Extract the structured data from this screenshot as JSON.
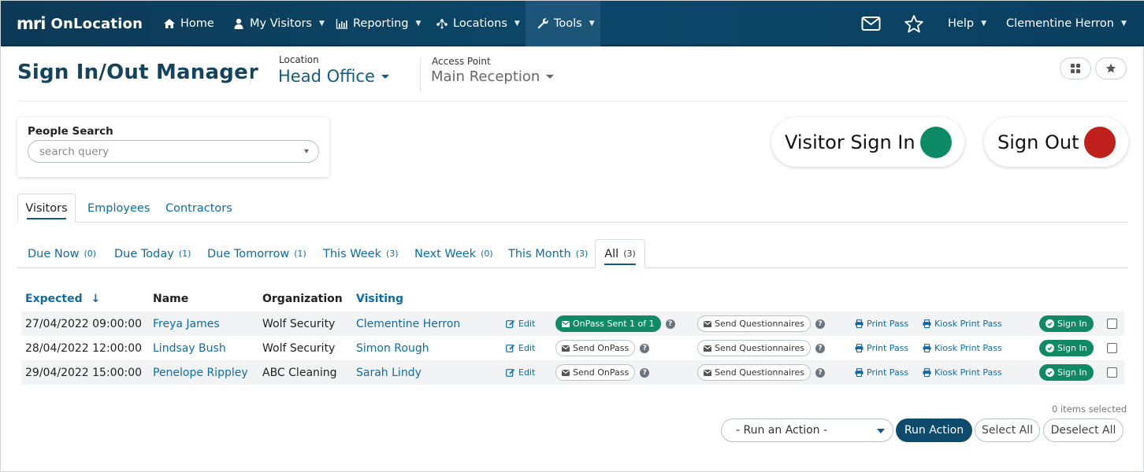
{
  "nav": {
    "brand_mark": "mri",
    "brand_name": "OnLocation",
    "items": [
      {
        "label": "Home",
        "icon": "home-icon"
      },
      {
        "label": "My Visitors",
        "icon": "user-icon"
      },
      {
        "label": "Reporting",
        "icon": "chart-icon"
      },
      {
        "label": "Locations",
        "icon": "network-icon"
      },
      {
        "label": "Tools",
        "icon": "wrench-icon"
      }
    ],
    "help_label": "Help",
    "user_label": "Clementine Herron"
  },
  "header": {
    "title": "Sign In/Out Manager",
    "location_label": "Location",
    "location_value": "Head Office",
    "access_point_label": "Access Point",
    "access_point_value": "Main Reception"
  },
  "search": {
    "label": "People Search",
    "placeholder": "search query"
  },
  "actions": {
    "visitor_sign_in": "Visitor Sign In",
    "sign_out": "Sign Out",
    "sign_in_color": "#0b8a65",
    "sign_out_color": "#c0201c"
  },
  "tabs": [
    "Visitors",
    "Employees",
    "Contractors"
  ],
  "subtabs": [
    {
      "label": "Due Now",
      "count": "(0)"
    },
    {
      "label": "Due Today",
      "count": "(1)"
    },
    {
      "label": "Due Tomorrow",
      "count": "(1)"
    },
    {
      "label": "This Week",
      "count": "(3)"
    },
    {
      "label": "Next Week",
      "count": "(0)"
    },
    {
      "label": "This Month",
      "count": "(3)"
    },
    {
      "label": "All",
      "count": "(3)"
    }
  ],
  "table": {
    "headers": {
      "expected": "Expected",
      "sort_arrow": "↓",
      "name": "Name",
      "organization": "Organization",
      "visiting": "Visiting"
    },
    "rows": [
      {
        "expected": "27/04/2022 09:00:00",
        "name": "Freya James",
        "organization": "Wolf Security",
        "visiting": "Clementine Herron",
        "edit": "Edit",
        "onpass": "OnPass Sent 1 of 1",
        "questionnaires": "Send Questionnaires",
        "print": "Print Pass",
        "kiosk": "Kiosk Print Pass",
        "sign_in": "Sign In"
      },
      {
        "expected": "28/04/2022 12:00:00",
        "name": "Lindsay Bush",
        "organization": "Wolf Security",
        "visiting": "Simon Rough",
        "edit": "Edit",
        "onpass": "Send OnPass",
        "questionnaires": "Send Questionnaires",
        "print": "Print Pass",
        "kiosk": "Kiosk Print Pass",
        "sign_in": "Sign In"
      },
      {
        "expected": "29/04/2022 15:00:00",
        "name": "Penelope Rippley",
        "organization": "ABC Cleaning",
        "visiting": "Sarah Lindy",
        "edit": "Edit",
        "onpass": "Send OnPass",
        "questionnaires": "Send Questionnaires",
        "print": "Print Pass",
        "kiosk": "Kiosk Print Pass",
        "sign_in": "Sign In"
      }
    ]
  },
  "footer": {
    "items_selected": "0 items selected",
    "action_placeholder": "- Run an Action -",
    "run_action": "Run Action",
    "select_all": "Select All",
    "deselect_all": "Deselect All"
  }
}
